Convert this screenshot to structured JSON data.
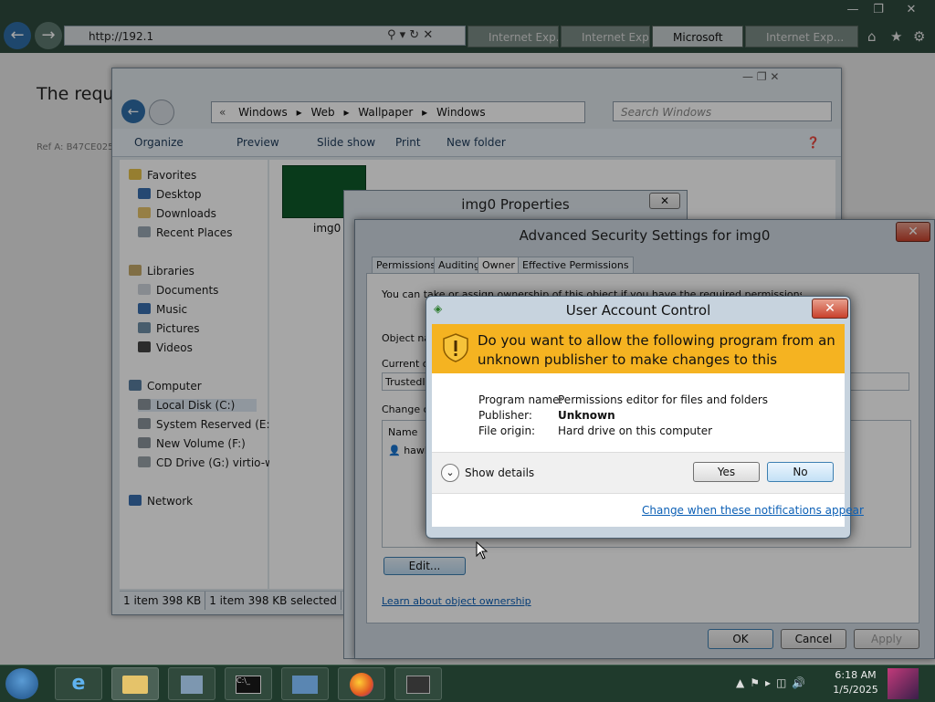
{
  "browser": {
    "address": "http://192.1",
    "tabs": [
      "Internet Exp...",
      "Internet Exp...",
      "Microsoft",
      "Internet Exp..."
    ],
    "page_heading": "The reque",
    "ref_text": "Ref A: B47CE025"
  },
  "explorer": {
    "breadcrumb": [
      "Windows",
      "Web",
      "Wallpaper",
      "Windows"
    ],
    "search_placeholder": "Search Windows",
    "toolbar": {
      "organize": "Organize",
      "preview": "Preview",
      "slideshow": "Slide show",
      "print": "Print",
      "new_folder": "New folder"
    },
    "nav": {
      "favorites": "Favorites",
      "desktop": "Desktop",
      "downloads": "Downloads",
      "recent_places": "Recent Places",
      "libraries": "Libraries",
      "documents": "Documents",
      "music": "Music",
      "pictures": "Pictures",
      "videos": "Videos",
      "computer": "Computer",
      "local_disk": "Local Disk (C:)",
      "system_reserved": "System Reserved (E:)",
      "new_volume": "New Volume (F:)",
      "cd_drive": "CD Drive (G:) virtio-w",
      "network": "Network"
    },
    "file_name": "img0",
    "status_count": "1 item 398 KB",
    "status_selected": "1 item 398 KB selected"
  },
  "properties": {
    "title": "img0 Properties"
  },
  "advanced": {
    "title": "Advanced Security Settings for img0",
    "tabs": [
      "Permissions",
      "Auditing",
      "Owner",
      "Effective Permissions"
    ],
    "info_text": "You can take or assign ownership of this object if you have the required permissions or privileges.",
    "object_name_label": "Object na",
    "current_owner_label": "Current ow",
    "current_owner_value": "TrustedIn",
    "change_owner_label": "Change ow",
    "name_col": "Name",
    "user_item": "hawk",
    "edit_button": "Edit...",
    "learn_link": "Learn about object ownership",
    "ok": "OK",
    "cancel": "Cancel",
    "apply": "Apply"
  },
  "uac": {
    "title": "User Account Control",
    "question": "Do you want to allow the following program from an unknown publisher to make changes to this computer?",
    "program_name_label": "Program name:",
    "program_name": "Permissions editor for files and folders",
    "publisher_label": "Publisher:",
    "publisher": "Unknown",
    "file_origin_label": "File origin:",
    "file_origin": "Hard drive on this computer",
    "show_details": "Show details",
    "yes": "Yes",
    "no": "No",
    "change_link": "Change when these notifications appear"
  },
  "taskbar": {
    "time": "6:18 AM",
    "date": "1/5/2025"
  },
  "colors": {
    "uac_banner": "#f5b321",
    "link": "#0b5fb5"
  }
}
